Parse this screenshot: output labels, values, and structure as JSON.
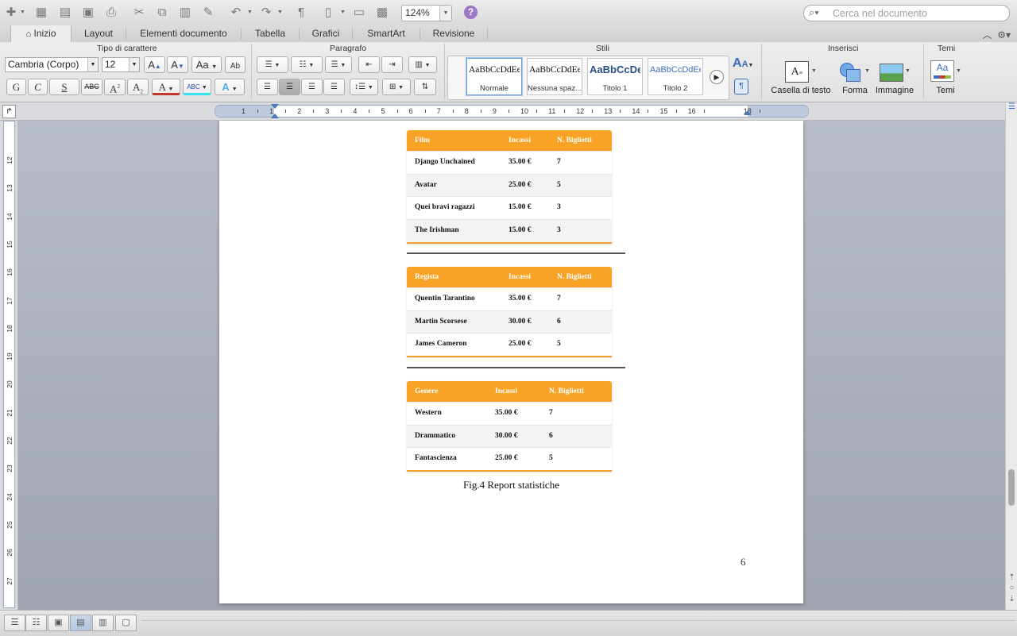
{
  "toolbar": {
    "zoom": "124%",
    "search_placeholder": "Cerca nel documento",
    "help": "?"
  },
  "tabs": [
    {
      "label": "Inizio",
      "active": true
    },
    {
      "label": "Layout"
    },
    {
      "label": "Elementi documento"
    },
    {
      "label": "Tabella"
    },
    {
      "label": "Grafici"
    },
    {
      "label": "SmartArt"
    },
    {
      "label": "Revisione"
    }
  ],
  "ribbon": {
    "groups": {
      "font": "Tipo di carattere",
      "paragraph": "Paragrafo",
      "styles": "Stili",
      "insert": "Inserisci",
      "themes": "Temi"
    },
    "font_name": "Cambria (Corpo)",
    "font_size": "12",
    "format_buttons": {
      "grow": "A",
      "shrink": "A",
      "case": "Aa",
      "clear": "Ab",
      "bold": "G",
      "italic": "C",
      "underline": "S",
      "strike": "ABC",
      "superscript": "A",
      "subscript": "A",
      "font_color": "A",
      "highlight": "ABC",
      "text_effects": "A"
    },
    "styles": [
      {
        "sample": "AaBbCcDdEe",
        "name": "Normale",
        "selected": true
      },
      {
        "sample": "AaBbCcDdEe",
        "name": "Nessuna spaz..."
      },
      {
        "sample": "AaBbCcDe",
        "name": "Titolo 1"
      },
      {
        "sample": "AaBbCcDdEe",
        "name": "Titolo 2"
      }
    ],
    "insert": {
      "textbox": "Casella di testo",
      "shape": "Forma",
      "image": "Immagine"
    },
    "themes_label": "Temi",
    "themes_sample": "Aa"
  },
  "ruler": {
    "h_numbers": [
      "1",
      "1",
      "2",
      "3",
      "4",
      "5",
      "6",
      "7",
      "8",
      "9",
      "10",
      "11",
      "12",
      "13",
      "14",
      "15",
      "16",
      "18"
    ],
    "v_numbers": [
      "12",
      "13",
      "14",
      "15",
      "16",
      "17",
      "18",
      "19",
      "20",
      "21",
      "22",
      "23",
      "24",
      "25",
      "26",
      "27"
    ]
  },
  "document": {
    "tables": [
      {
        "headers": [
          "Film",
          "Incassi",
          "N. Biglietti"
        ],
        "rows": [
          [
            "Django Unchained",
            "35.00 €",
            "7"
          ],
          [
            "Avatar",
            "25.00 €",
            "5"
          ],
          [
            "Quei bravi ragazzi",
            "15.00 €",
            "3"
          ],
          [
            "The Irishman",
            "15.00 €",
            "3"
          ]
        ]
      },
      {
        "headers": [
          "Regista",
          "Incassi",
          "N. Biglietti"
        ],
        "rows": [
          [
            "Quentin Tarantino",
            "35.00 €",
            "7"
          ],
          [
            "Martin Scorsese",
            "30.00 €",
            "6"
          ],
          [
            "James Cameron",
            "25.00 €",
            "5"
          ]
        ]
      },
      {
        "headers": [
          "Genere",
          "Incassi",
          "N. Biglietti"
        ],
        "rows": [
          [
            "Western",
            "35.00 €",
            "7"
          ],
          [
            "Drammatico",
            "30.00 €",
            "6"
          ],
          [
            "Fantascienza",
            "25.00 €",
            "5"
          ]
        ]
      }
    ],
    "caption": "Fig.4 Report statistiche",
    "page_number": "6"
  },
  "colors": {
    "table_header": "#f9a326",
    "page": "#ffffff",
    "canvas": "#a7acb6"
  }
}
